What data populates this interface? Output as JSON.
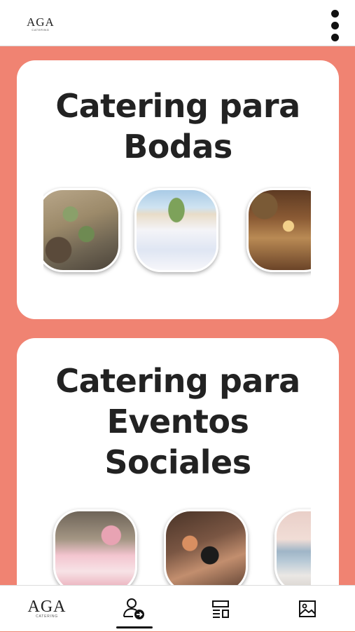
{
  "header": {
    "logo_text": "AGA",
    "logo_subtext": "CATERING",
    "menu_icon": "kebab-menu-icon"
  },
  "sections": [
    {
      "title_line1": "Catering para",
      "title_line2": "Bodas",
      "images": [
        "landscape-village-photo",
        "outdoor-wedding-aisle-photo",
        "decorated-hall-chandelier-photo"
      ]
    },
    {
      "title_line1": "Catering para",
      "title_line2": "Eventos",
      "title_line3": "Sociales",
      "images": [
        "pink-table-setting-photo",
        "food-platter-photo",
        "seaside-terrace-photo"
      ]
    }
  ],
  "bottom_nav": {
    "logo_text": "AGA",
    "logo_subtext": "CATERING",
    "items": [
      {
        "icon": "user-arrow-icon",
        "active": true
      },
      {
        "icon": "layout-icon",
        "active": false
      },
      {
        "icon": "image-gallery-icon",
        "active": false
      }
    ]
  },
  "colors": {
    "background": "#f08372",
    "card": "#ffffff",
    "text": "#222222"
  }
}
